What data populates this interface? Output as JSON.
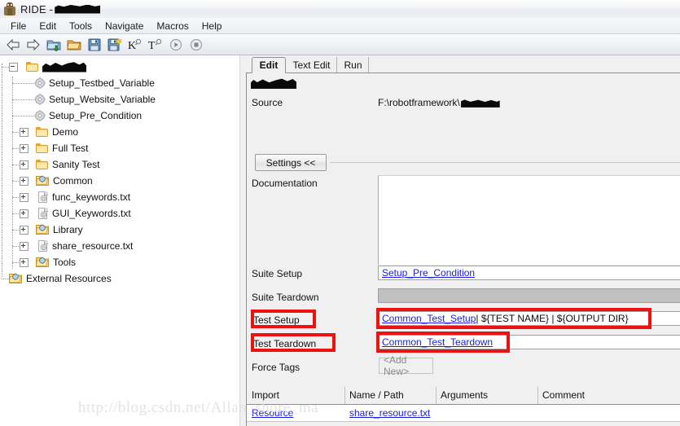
{
  "window": {
    "title_prefix": "RIDE - ",
    "title_redacted": true,
    "app_icon": "robot-icon"
  },
  "menubar": {
    "items": [
      {
        "label": "File"
      },
      {
        "label": "Edit"
      },
      {
        "label": "Tools"
      },
      {
        "label": "Navigate"
      },
      {
        "label": "Macros"
      },
      {
        "label": "Help"
      }
    ]
  },
  "toolbar": {
    "buttons": [
      {
        "name": "back-arrow-icon",
        "title": "Back"
      },
      {
        "name": "forward-arrow-icon",
        "title": "Forward"
      },
      {
        "name": "open-directory-icon",
        "title": "Open Directory"
      },
      {
        "name": "open-folder-icon",
        "title": "Open"
      },
      {
        "name": "save-icon",
        "title": "Save"
      },
      {
        "name": "save-all-icon",
        "title": "Save All"
      },
      {
        "name": "search-keyword-icon",
        "title": "Search Keywords"
      },
      {
        "name": "search-test-icon",
        "title": "Search Tests"
      },
      {
        "name": "run-icon",
        "title": "Run"
      },
      {
        "name": "stop-icon",
        "title": "Stop"
      }
    ]
  },
  "tree": {
    "root": {
      "label": "",
      "redacted": true,
      "expanded": true,
      "icon": "folder-icon"
    },
    "items": [
      {
        "label": "Setup_Testbed_Variable",
        "icon": "gear-icon",
        "indent": 2,
        "expander": "none"
      },
      {
        "label": "Setup_Website_Variable",
        "icon": "gear-icon",
        "indent": 2,
        "expander": "none"
      },
      {
        "label": "Setup_Pre_Condition",
        "icon": "gear-icon",
        "indent": 2,
        "expander": "none"
      },
      {
        "label": "Demo",
        "icon": "folder-icon",
        "indent": 1,
        "expander": "plus"
      },
      {
        "label": "Full Test",
        "icon": "folder-icon",
        "indent": 1,
        "expander": "plus"
      },
      {
        "label": "Sanity Test",
        "icon": "folder-icon",
        "indent": 1,
        "expander": "plus"
      },
      {
        "label": "Common",
        "icon": "resource-folder-icon",
        "indent": 1,
        "expander": "plus"
      },
      {
        "label": "func_keywords.txt",
        "icon": "document-icon",
        "indent": 1,
        "expander": "plus"
      },
      {
        "label": "GUI_Keywords.txt",
        "icon": "document-icon",
        "indent": 1,
        "expander": "plus"
      },
      {
        "label": "Library",
        "icon": "resource-folder-icon",
        "indent": 1,
        "expander": "plus"
      },
      {
        "label": "share_resource.txt",
        "icon": "document-icon",
        "indent": 1,
        "expander": "plus"
      },
      {
        "label": "Tools",
        "icon": "resource-folder-icon",
        "indent": 1,
        "expander": "plus"
      },
      {
        "label": "External Resources",
        "icon": "resource-folder-icon",
        "indent": 0,
        "expander": "none"
      }
    ]
  },
  "editor": {
    "tabs": [
      {
        "label": "Edit",
        "active": true
      },
      {
        "label": "Text Edit",
        "active": false
      },
      {
        "label": "Run",
        "active": false
      }
    ],
    "suite_name_redacted": true,
    "source": {
      "label": "Source",
      "value": "F:\\robotframework\\",
      "value_redacted": true
    },
    "settings_button": "Settings <<",
    "fields": [
      {
        "name": "documentation",
        "label": "Documentation",
        "value": "",
        "type": "textarea"
      },
      {
        "name": "suite-setup",
        "label": "Suite Setup",
        "value": "Setup_Pre_Condition",
        "type": "link",
        "highlight_label": false,
        "highlight_value": false
      },
      {
        "name": "suite-teardown",
        "label": "Suite Teardown",
        "value": "",
        "type": "disabled",
        "highlight_label": false,
        "highlight_value": false
      },
      {
        "name": "test-setup",
        "label": "Test Setup",
        "value_link": "Common_Test_Setup",
        "value_rest": " | ${TEST NAME} | ${OUTPUT DIR}",
        "type": "link-plus",
        "highlight_label": true,
        "highlight_value": true
      },
      {
        "name": "test-teardown",
        "label": "Test Teardown",
        "value_link": "Common_Test_Teardown",
        "value_rest": "",
        "type": "link-plus",
        "highlight_label": true,
        "highlight_value": true
      },
      {
        "name": "force-tags",
        "label": "Force Tags",
        "value": "<Add New>",
        "type": "addnew",
        "highlight_label": false,
        "highlight_value": false
      }
    ],
    "import_table": {
      "headers": [
        "Import",
        "Name / Path",
        "Arguments",
        "Comment"
      ],
      "rows": [
        {
          "import": "Resource",
          "name_path": "share_resource.txt",
          "arguments": "",
          "comment": ""
        }
      ]
    }
  },
  "watermark": {
    "text": "http://blog.csdn.net/Allan_shore_ma"
  },
  "colors": {
    "highlight": "#ee1111",
    "link": "#1c1cdc",
    "window_bg": "#f0f0f0",
    "tree_bg": "#ffffff",
    "disabled_field": "#c0c0c0"
  }
}
